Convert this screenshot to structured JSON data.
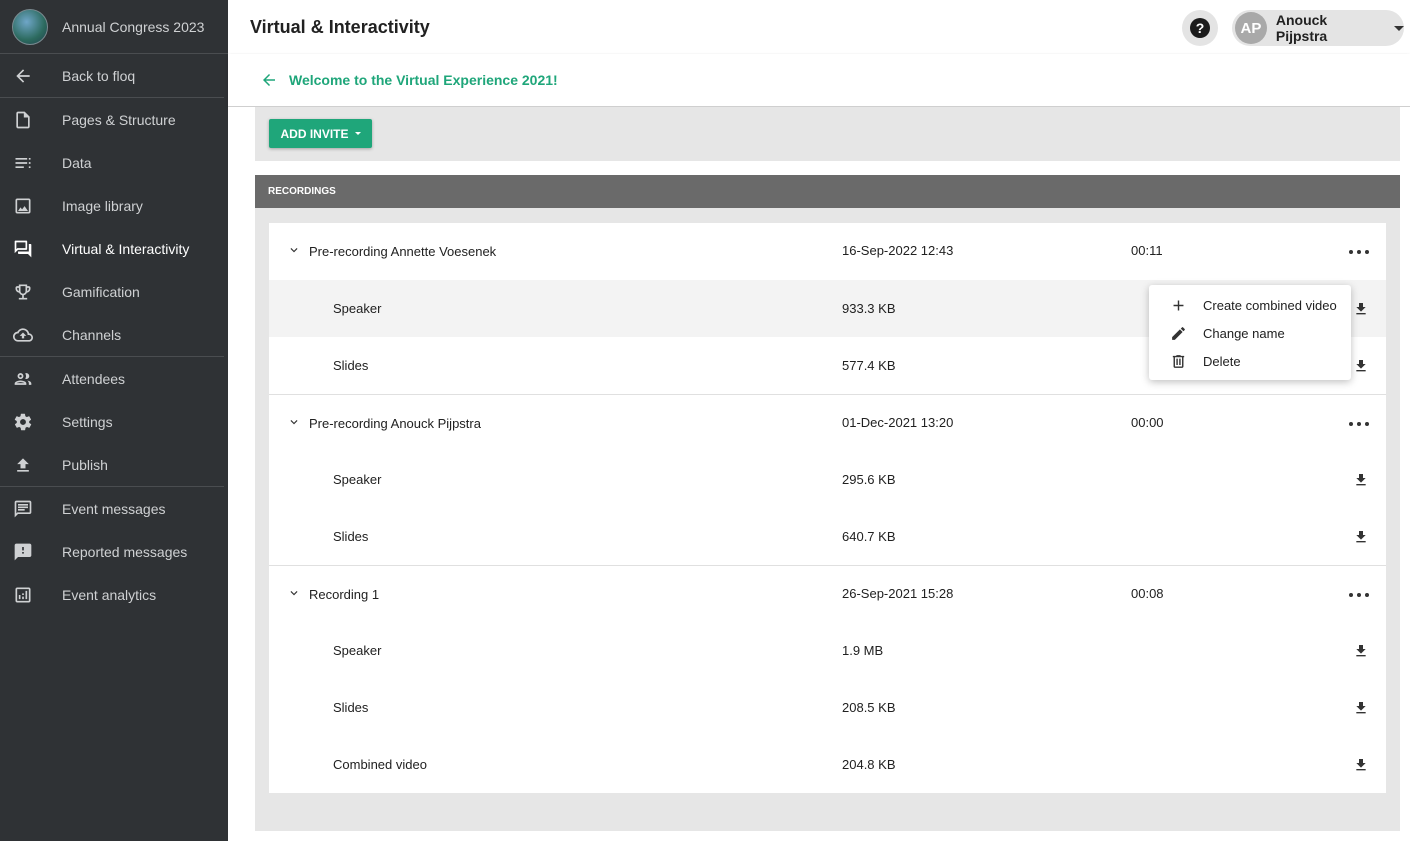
{
  "sidebar": {
    "event_title": "Annual Congress 2023",
    "items": [
      {
        "label": "Back to floq",
        "icon": "arrow-left-icon"
      },
      {
        "label": "Pages & Structure",
        "icon": "page-icon"
      },
      {
        "label": "Data",
        "icon": "list-icon"
      },
      {
        "label": "Image library",
        "icon": "image-icon"
      },
      {
        "label": "Virtual & Interactivity",
        "icon": "chat-bubbles-icon"
      },
      {
        "label": "Gamification",
        "icon": "trophy-icon"
      },
      {
        "label": "Channels",
        "icon": "cloud-upload-icon"
      },
      {
        "label": "Attendees",
        "icon": "people-icon"
      },
      {
        "label": "Settings",
        "icon": "gear-icon"
      },
      {
        "label": "Publish",
        "icon": "publish-icon"
      },
      {
        "label": "Event messages",
        "icon": "message-icon"
      },
      {
        "label": "Reported messages",
        "icon": "report-message-icon"
      },
      {
        "label": "Event analytics",
        "icon": "analytics-icon"
      }
    ]
  },
  "header": {
    "title": "Virtual & Interactivity",
    "help_label": "?",
    "user_initials": "AP",
    "user_name": "Anouck Pijpstra"
  },
  "breadcrumb": {
    "label": "Welcome to the Virtual Experience 2021!"
  },
  "invite": {
    "button_label": "ADD INVITE"
  },
  "recordings": {
    "header": "RECORDINGS",
    "groups": [
      {
        "name": "Pre-recording Annette Voesenek",
        "date": "16-Sep-2022 12:43",
        "duration": "00:11",
        "files": [
          {
            "name": "Speaker",
            "size": "933.3 KB"
          },
          {
            "name": "Slides",
            "size": "577.4 KB"
          }
        ]
      },
      {
        "name": "Pre-recording Anouck Pijpstra",
        "date": "01-Dec-2021 13:20",
        "duration": "00:00",
        "files": [
          {
            "name": "Speaker",
            "size": "295.6 KB"
          },
          {
            "name": "Slides",
            "size": "640.7 KB"
          }
        ]
      },
      {
        "name": "Recording 1",
        "date": "26-Sep-2021 15:28",
        "duration": "00:08",
        "files": [
          {
            "name": "Speaker",
            "size": "1.9 MB"
          },
          {
            "name": "Slides",
            "size": "208.5 KB"
          },
          {
            "name": "Combined video",
            "size": "204.8 KB"
          }
        ]
      }
    ]
  },
  "context_menu": {
    "items": [
      {
        "label": "Create combined video",
        "icon": "plus-icon"
      },
      {
        "label": "Change name",
        "icon": "pencil-icon"
      },
      {
        "label": "Delete",
        "icon": "trash-icon"
      }
    ]
  },
  "colors": {
    "accent": "#1fa67a",
    "sidebar_bg": "#2f3235",
    "section_header_bg": "#6a6a6a"
  }
}
